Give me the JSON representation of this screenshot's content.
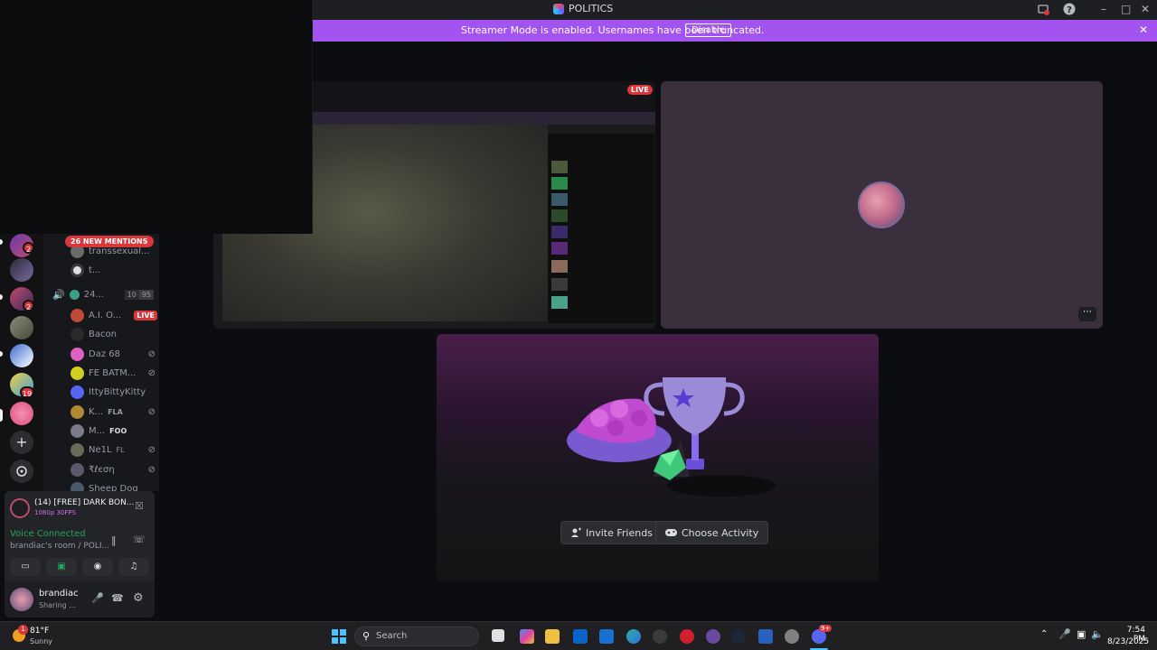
{
  "window": {
    "title": "POLITICS"
  },
  "banner": {
    "message": "Streamer Mode is enabled. Usernames have been truncated.",
    "disable_label": "Disable"
  },
  "rail": {
    "badges": [
      "2",
      "2",
      "19"
    ],
    "colors": {
      "rail_bg": "#121214",
      "badge": "#da373c"
    }
  },
  "channels": {
    "mentions_label": "26 NEW MENTIONS",
    "partial_top": "transsexual...",
    "item_t": "t...",
    "voice_channel": {
      "name": "24...",
      "count": "10",
      "limit": "95"
    },
    "members": [
      {
        "name": "A.I. O...",
        "live": "LIVE"
      },
      {
        "name": "Bacon"
      },
      {
        "name": "Daz 68"
      },
      {
        "name": "FE BATM..."
      },
      {
        "name": "IttyBittyKitty"
      },
      {
        "name": "K...",
        "tag": "FLA"
      },
      {
        "name": "M...",
        "tag": "FOO"
      },
      {
        "name": "Ne1L",
        "tag": "FL"
      },
      {
        "name": "₹ℓєση"
      },
      {
        "name": "Sheep Dog"
      }
    ]
  },
  "stream_panel": {
    "title": "(14) [FREE] DARK BON...",
    "quality": "1080p 30FPS",
    "voice_status": "Voice Connected",
    "voice_location": "brandiac's room / POLI..."
  },
  "user": {
    "name": "brandiac",
    "status": "Sharing ..."
  },
  "stage": {
    "live_label": "LIVE",
    "invite_label": "Invite Friends",
    "activity_label": "Choose Activity",
    "accent": "#a353f0"
  },
  "taskbar": {
    "weather_temp": "81°F",
    "weather_desc": "Sunny",
    "weather_badge": "1",
    "search_placeholder": "Search",
    "time": "7:54 PM",
    "date": "8/23/2025",
    "discord_badge": "9+"
  }
}
